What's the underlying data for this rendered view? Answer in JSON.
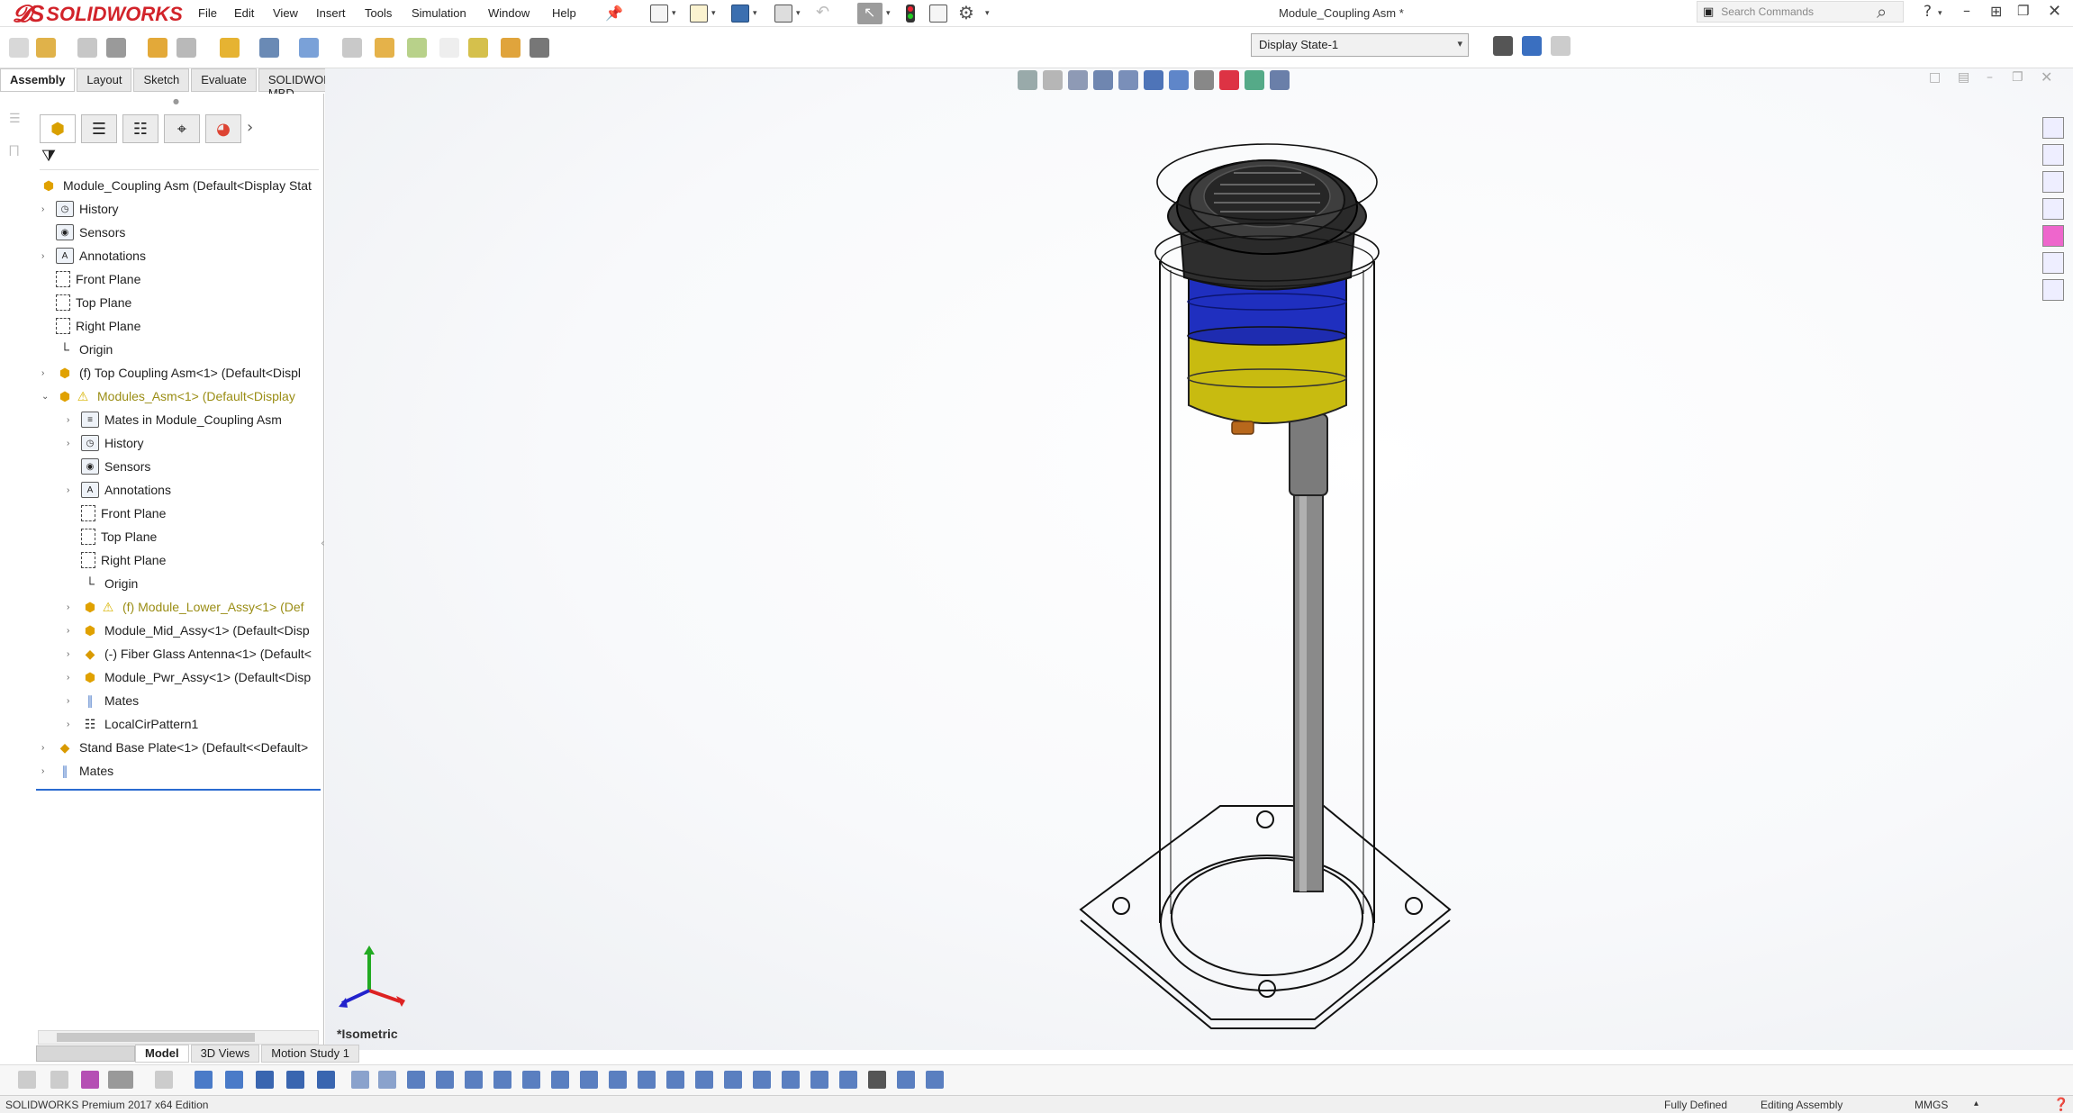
{
  "app": {
    "brand": "SOLIDWORKS",
    "document_title": "Module_Coupling Asm *"
  },
  "menu": [
    "File",
    "Edit",
    "View",
    "Insert",
    "Tools",
    "Simulation",
    "Window",
    "Help"
  ],
  "search": {
    "placeholder": "Search Commands"
  },
  "display_state": {
    "value": "Display State-1"
  },
  "command_tabs": [
    "Assembly",
    "Layout",
    "Sketch",
    "Evaluate",
    "SOLIDWORKS MBD"
  ],
  "active_command_tab": "Assembly",
  "tree": {
    "root": "Module_Coupling Asm  (Default<Display Stat",
    "items": [
      {
        "label": "History",
        "icon": "history-folder-icon"
      },
      {
        "label": "Sensors",
        "icon": "sensors-icon"
      },
      {
        "label": "Annotations",
        "icon": "annotations-icon"
      },
      {
        "label": "Front Plane",
        "icon": "plane-icon"
      },
      {
        "label": "Top Plane",
        "icon": "plane-icon"
      },
      {
        "label": "Right Plane",
        "icon": "plane-icon"
      },
      {
        "label": "Origin",
        "icon": "origin-icon"
      },
      {
        "label": "(f) Top Coupling Asm<1> (Default<Displ",
        "icon": "assembly-icon"
      },
      {
        "label": "Modules_Asm<1> (Default<Display",
        "icon": "assembly-warning-icon"
      },
      {
        "label": "Mates in Module_Coupling Asm",
        "icon": "mates-folder-icon"
      },
      {
        "label": "History",
        "icon": "history-folder-icon"
      },
      {
        "label": "Sensors",
        "icon": "sensors-icon"
      },
      {
        "label": "Annotations",
        "icon": "annotations-icon"
      },
      {
        "label": "Front Plane",
        "icon": "plane-icon"
      },
      {
        "label": "Top Plane",
        "icon": "plane-icon"
      },
      {
        "label": "Right Plane",
        "icon": "plane-icon"
      },
      {
        "label": "Origin",
        "icon": "origin-icon"
      },
      {
        "label": "(f) Module_Lower_Assy<1> (Def",
        "icon": "assembly-warning-icon"
      },
      {
        "label": "Module_Mid_Assy<1> (Default<Disp",
        "icon": "assembly-icon"
      },
      {
        "label": "(-) Fiber Glass Antenna<1> (Default<",
        "icon": "part-icon"
      },
      {
        "label": "Module_Pwr_Assy<1> (Default<Disp",
        "icon": "assembly-icon"
      },
      {
        "label": "Mates",
        "icon": "mates-icon"
      },
      {
        "label": "LocalCirPattern1",
        "icon": "pattern-icon"
      },
      {
        "label": "Stand Base Plate<1> (Default<<Default>",
        "icon": "part-icon"
      },
      {
        "label": "Mates",
        "icon": "mates-icon"
      }
    ]
  },
  "view": {
    "orientation_label": "*Isometric"
  },
  "bottom_tabs": [
    "Model",
    "3D Views",
    "Motion Study 1"
  ],
  "active_bottom_tab": "Model",
  "status": {
    "edition": "SOLIDWORKS Premium 2017 x64 Edition",
    "definition": "Fully Defined",
    "mode": "Editing Assembly",
    "units": "MMGS"
  },
  "colors": {
    "brand_red": "#d2232a",
    "module_blue": "#1f2fbf",
    "module_yellow": "#c8bb10",
    "warning_text": "#9a8d14",
    "tree_underline": "#2a6bd0"
  }
}
